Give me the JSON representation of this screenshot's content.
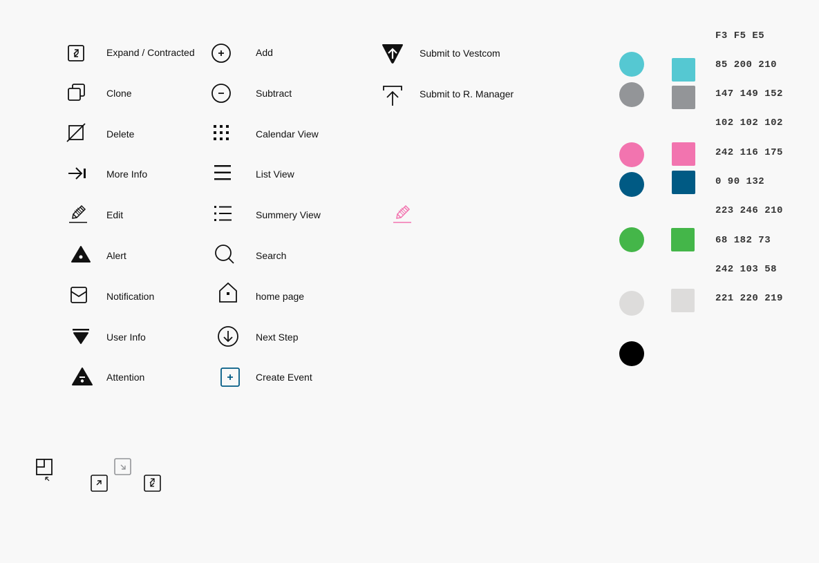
{
  "col1": [
    {
      "label": "Expand / Contracted",
      "icon": "expand-icon"
    },
    {
      "label": "Clone",
      "icon": "clone-icon"
    },
    {
      "label": "Delete",
      "icon": "delete-icon"
    },
    {
      "label": "More Info",
      "icon": "more-info-icon"
    },
    {
      "label": "Edit",
      "icon": "edit-icon"
    },
    {
      "label": "Alert",
      "icon": "alert-icon"
    },
    {
      "label": "Notification",
      "icon": "notification-icon"
    },
    {
      "label": "User Info",
      "icon": "user-info-icon"
    },
    {
      "label": "Attention",
      "icon": "attention-icon"
    }
  ],
  "col2": [
    {
      "label": "Add",
      "icon": "add-icon"
    },
    {
      "label": "Subtract",
      "icon": "subtract-icon"
    },
    {
      "label": "Calendar View",
      "icon": "calendar-view-icon"
    },
    {
      "label": "List View",
      "icon": "list-view-icon"
    },
    {
      "label": "Summery View",
      "icon": "summary-view-icon"
    },
    {
      "label": "Search",
      "icon": "search-icon"
    },
    {
      "label": "home page",
      "icon": "home-icon"
    },
    {
      "label": "Next Step",
      "icon": "next-step-icon"
    },
    {
      "label": "Create Event",
      "icon": "create-event-icon"
    }
  ],
  "col3": [
    {
      "label": "Submit to Vestcom",
      "icon": "submit-vestcom-icon"
    },
    {
      "label": "Submit to R. Manager",
      "icon": "submit-manager-icon"
    }
  ],
  "accent_edit_icon": {
    "icon": "edit-icon-pink",
    "color": "#F274AF"
  },
  "palette": {
    "codes": [
      "F3 F5 E5",
      "85 200 210",
      "147 149 152",
      "102 102 102",
      "242 116 175",
      "0 90 132",
      "223 246 210",
      "68 182 73",
      "242 103 58",
      "221 220 219"
    ],
    "circles": [
      "#55C8D2",
      "#939598",
      "#F274AF",
      "#005A84",
      "#44B649",
      "#DDDCDB",
      "#000000"
    ],
    "squares": [
      "#55C8D2",
      "#939598",
      "#F274AF",
      "#005A84",
      "#44B649",
      "#DDDCDB"
    ]
  },
  "bottom_icons": [
    "restore-window-icon",
    "collapse-icon",
    "expand-small-icon",
    "expand-corner-icon"
  ]
}
